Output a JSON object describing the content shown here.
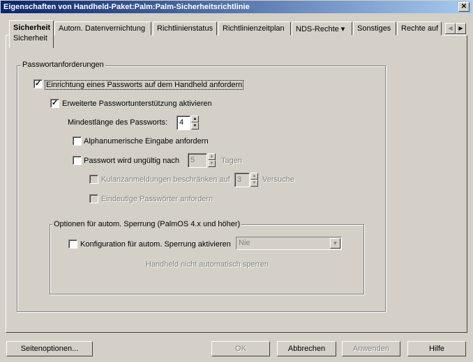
{
  "window": {
    "title": "Eigenschaften von Handheld-Paket:Palm:Palm-Sicherheitsrichtlinie",
    "close": "✕"
  },
  "tabs": [
    {
      "label": "Sicherheit",
      "sub": "Sicherheit"
    },
    {
      "label": "Autom. Datenvernichtung"
    },
    {
      "label": "Richtlinienstatus"
    },
    {
      "label": "Richtlinienzeitplan"
    },
    {
      "label": "NDS-Rechte ▾"
    },
    {
      "label": "Sonstiges"
    },
    {
      "label": "Rechte auf"
    }
  ],
  "tab_scroll": {
    "left": "◀",
    "right": "▶"
  },
  "password_group": {
    "legend": "Passwortanforderungen",
    "require": {
      "label": "Einrichtung eines Passworts auf dem Handheld anfordern",
      "checked": true
    },
    "extended": {
      "label": "Erweiterte Passwortunterstützung aktivieren",
      "checked": true
    },
    "min_length": {
      "label": "Mindestlänge des Passworts:",
      "value": "4"
    },
    "alnum": {
      "label": "Alphanumerische Eingabe anfordern",
      "checked": false
    },
    "expire": {
      "label": "Passwort wird ungültig nach",
      "value": "5",
      "unit": "Tagen",
      "checked": false
    },
    "grace": {
      "label": "Kulanzanmeldungen beschränken auf",
      "value": "3",
      "unit": "Versuche",
      "checked": false
    },
    "unique": {
      "label": "Eindeutige Passwörter anfordern",
      "checked": false
    }
  },
  "lock_group": {
    "legend": "Optionen für autom. Sperrung (PalmOS 4.x und höher)",
    "enable": {
      "label": "Konfiguration für autom. Sperrung aktivieren",
      "checked": false
    },
    "dropdown": "Nie",
    "info": "Handheld nicht automatisch sperren"
  },
  "buttons": {
    "page_options": "Seitenoptionen...",
    "ok": "OK",
    "cancel": "Abbrechen",
    "apply": "Anwenden",
    "help": "Hilfe"
  },
  "check": "✓",
  "up": "▲",
  "down": "▼"
}
